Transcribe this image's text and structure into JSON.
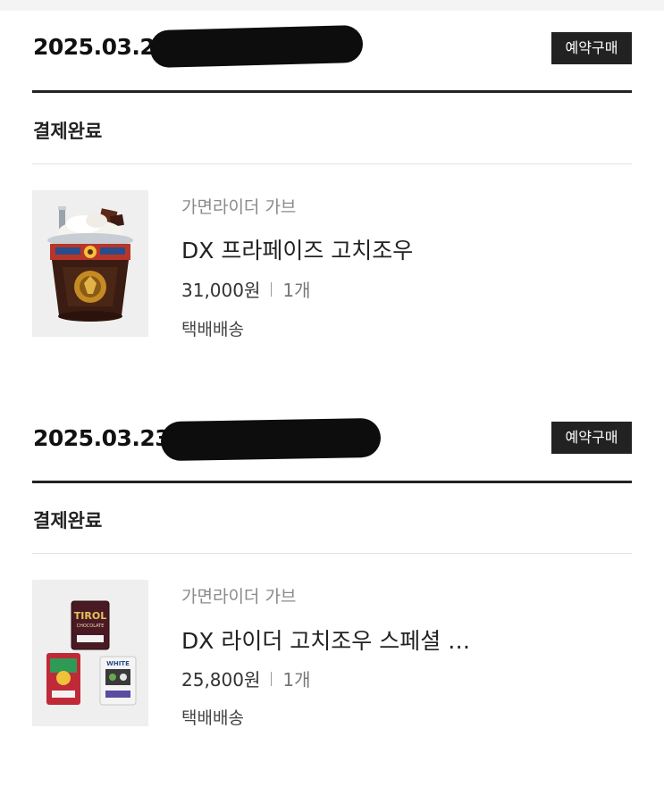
{
  "orders": [
    {
      "date": "2025.03.23",
      "badge": "예약구매",
      "status": "결제완료",
      "item": {
        "brand": "가면라이더 가브",
        "name": "DX 프라페이즈 고치조우",
        "price": "31,000원",
        "qty": "1개",
        "shipping": "택배배송",
        "image_icon": "product-frappe-cup-image"
      }
    },
    {
      "date": "2025.03.23",
      "badge": "예약구매",
      "status": "결제완료",
      "item": {
        "brand": "가면라이더 가브",
        "name": "DX 라이더 고치조우 스페셜 …",
        "price": "25,800원",
        "qty": "1개",
        "shipping": "택배배송",
        "image_icon": "product-chocolate-set-image",
        "image_text": [
          "TIROL",
          "CHOCOLATE",
          "WHITE"
        ]
      }
    }
  ],
  "colors": {
    "badge_bg": "#222222",
    "badge_fg": "#ffffff",
    "muted_text": "#8a8a8a",
    "rule": "#222222"
  }
}
